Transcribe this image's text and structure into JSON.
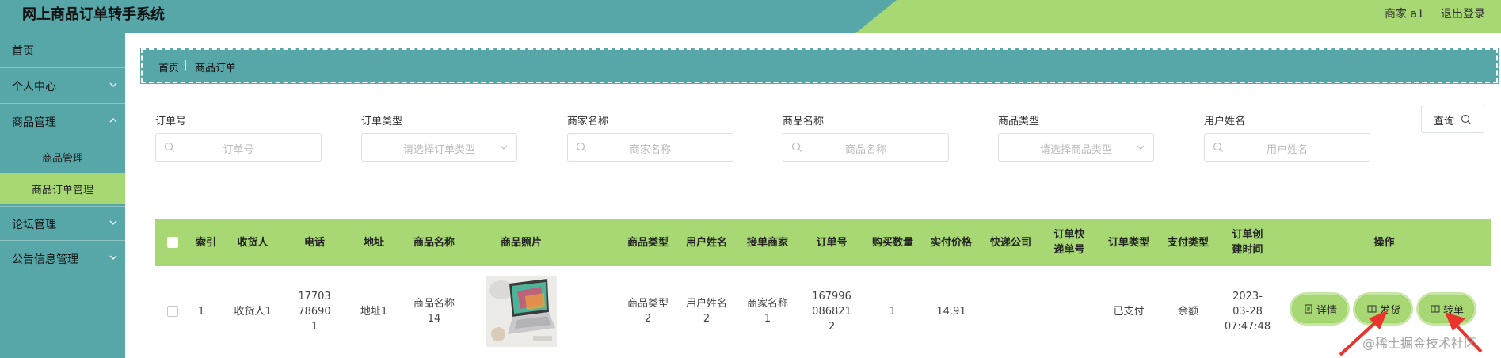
{
  "header": {
    "title": "网上商品订单转手系统",
    "user": "商家 a1",
    "logout": "退出登录"
  },
  "sidebar": {
    "items": [
      {
        "label": "首页"
      },
      {
        "label": "个人中心"
      },
      {
        "label": "商品管理"
      },
      {
        "label": "论坛管理"
      },
      {
        "label": "公告信息管理"
      }
    ],
    "subitems": [
      {
        "label": "商品管理"
      },
      {
        "label": "商品订单管理"
      }
    ]
  },
  "breadcrumb": {
    "home": "首页",
    "sep": "|",
    "current": "商品订单"
  },
  "search": {
    "fields": [
      {
        "label": "订单号",
        "placeholder": "订单号"
      },
      {
        "label": "订单类型",
        "placeholder": "请选择订单类型"
      },
      {
        "label": "商家名称",
        "placeholder": "商家名称"
      },
      {
        "label": "商品名称",
        "placeholder": "商品名称"
      },
      {
        "label": "商品类型",
        "placeholder": "请选择商品类型"
      },
      {
        "label": "用户姓名",
        "placeholder": "用户姓名"
      }
    ],
    "query_label": "查询"
  },
  "table": {
    "headers": [
      "索引",
      "收货人",
      "电话",
      "地址",
      "商品名称",
      "商品照片",
      "商品类型",
      "用户姓名",
      "接单商家",
      "订单号",
      "购买数量",
      "实付价格",
      "快递公司",
      "订单快递单号",
      "订单类型",
      "支付类型",
      "订单创建时间",
      "操作"
    ],
    "rows": [
      {
        "index": "1",
        "receiver": "收货人1",
        "phone": "17703786901",
        "address": "地址1",
        "product_name": "商品名称14",
        "product_type": "商品类型2",
        "user_name": "用户姓名2",
        "merchant": "商家名称1",
        "order_no": "1679960868212",
        "quantity": "1",
        "price": "14.91",
        "courier": "",
        "tracking_no": "",
        "order_type": "已支付",
        "pay_type": "余额",
        "created": "2023-03-28 07:47:48"
      }
    ],
    "actions": {
      "detail": "详情",
      "ship": "发货",
      "transfer": "转单"
    }
  },
  "watermark": "@稀土掘金技术社区",
  "colors": {
    "teal": "#58a7a8",
    "green": "#a8d873",
    "arrow": "#e8342c"
  }
}
